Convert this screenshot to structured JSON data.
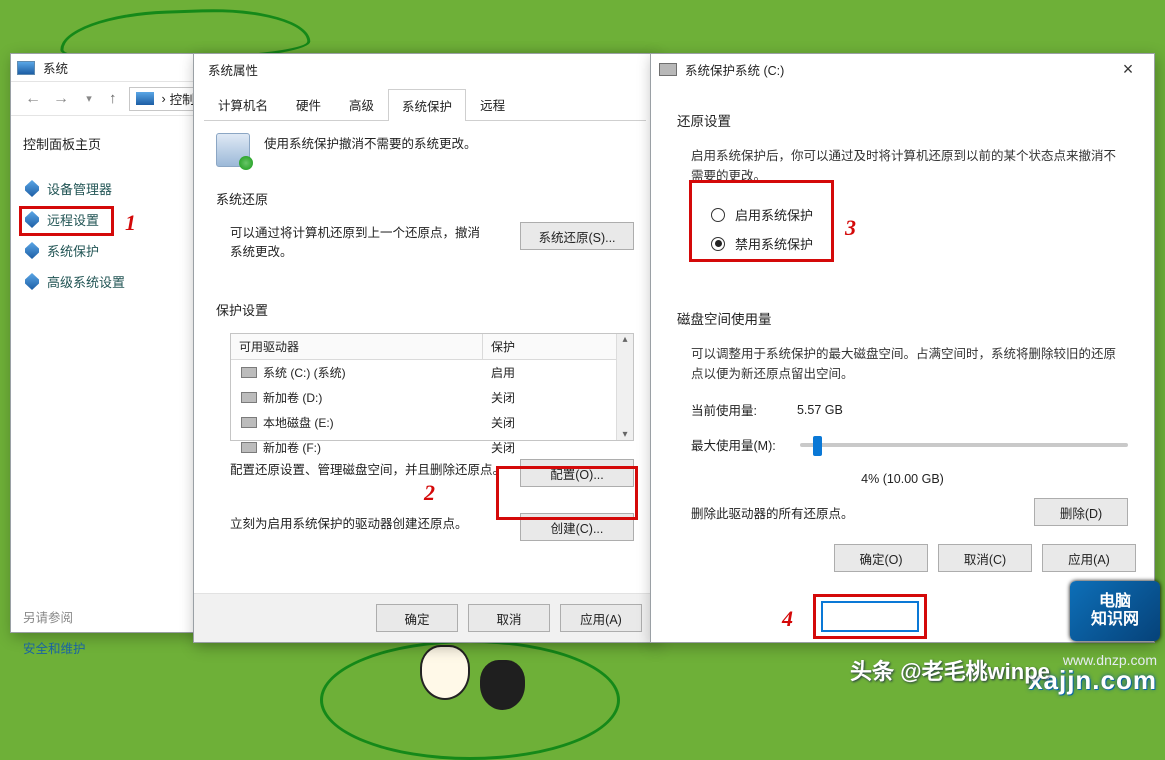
{
  "w1": {
    "title": "系统",
    "breadcrumb": "控制面板",
    "sidebar_home": "控制面板主页",
    "nav": {
      "device_mgr": "设备管理器",
      "remote": "远程设置",
      "protection": "系统保护",
      "advanced": "高级系统设置"
    },
    "see_also_label": "另请参阅",
    "see_also_link": "安全和维护"
  },
  "w2": {
    "title": "系统属性",
    "tabs": {
      "computer_name": "计算机名",
      "hardware": "硬件",
      "advanced": "高级",
      "protection": "系统保护",
      "remote": "远程"
    },
    "intro": "使用系统保护撤消不需要的系统更改。",
    "section_restore": "系统还原",
    "restore_desc_l1": "可以通过将计算机还原到上一个还原点，撤消",
    "restore_desc_l2": "系统更改。",
    "btn_restore": "系统还原(S)...",
    "section_settings": "保护设置",
    "col_drive": "可用驱动器",
    "col_protect": "保护",
    "drives": [
      {
        "name": "系统 (C:) (系统)",
        "protect": "启用"
      },
      {
        "name": "新加卷 (D:)",
        "protect": "关闭"
      },
      {
        "name": "本地磁盘 (E:)",
        "protect": "关闭"
      },
      {
        "name": "新加卷 (F:)",
        "protect": "关闭"
      }
    ],
    "configure_desc": "配置还原设置、管理磁盘空间，并且删除还原点。",
    "btn_configure": "配置(O)...",
    "create_desc": "立刻为启用系统保护的驱动器创建还原点。",
    "btn_create": "创建(C)...",
    "btn_ok": "确定",
    "btn_cancel": "取消",
    "btn_apply": "应用(A)"
  },
  "w3": {
    "title": "系统保护系统 (C:)",
    "section_restore": "还原设置",
    "restore_desc": "启用系统保护后，你可以通过及时将计算机还原到以前的某个状态点来撤消不需要的更改。",
    "radio_enable": "启用系统保护",
    "radio_disable": "禁用系统保护",
    "section_disk": "磁盘空间使用量",
    "disk_desc": "可以调整用于系统保护的最大磁盘空间。占满空间时，系统将删除较旧的还原点以便为新还原点留出空间。",
    "current_label": "当前使用量:",
    "current_value": "5.57 GB",
    "max_label": "最大使用量(M):",
    "slider_pct": 4,
    "slider_text": "4% (10.00 GB)",
    "delete_desc": "删除此驱动器的所有还原点。",
    "btn_delete": "删除(D)",
    "btn_ok": "确定(O)",
    "btn_cancel": "取消(C)",
    "btn_apply": "应用(A)"
  },
  "annotations": {
    "a1": "1",
    "a2": "2",
    "a3": "3",
    "a4": "4"
  },
  "credits": {
    "headline": "头条 @老毛桃winpe",
    "site": "www.dnzp.com",
    "logo": "电脑\n知识网",
    "xajjn": "xajjn.com"
  }
}
